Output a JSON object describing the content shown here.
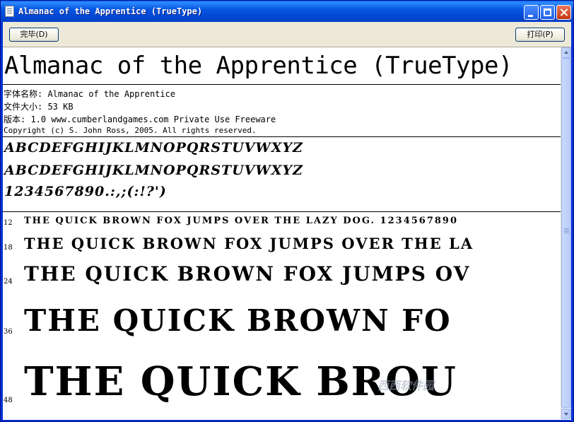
{
  "window": {
    "title": "Almanac of the Apprentice (TrueType)",
    "icon": "document-icon"
  },
  "toolbar": {
    "done_label": "完毕(D)",
    "print_label": "打印(P)"
  },
  "font_info": {
    "display_name": "Almanac of the Apprentice (TrueType)",
    "name_line": "字体名称: Almanac of the Apprentice",
    "size_line": "文件大小: 53 KB",
    "version_line": "版本: 1.0 www.cumberlandgames.com Private Use Freeware",
    "copyright_line": "Copyright (c) S. John Ross, 2005. All rights reserved."
  },
  "charset": {
    "uppercase_1": "ABCDEFGHIJKLMNOPQRSTUVWXYZ",
    "uppercase_2": "ABCDEFGHIJKLMNOPQRSTUVWXYZ",
    "digits_punct": "1234567890.:,;(:!?')"
  },
  "samples": [
    {
      "size": "12",
      "text": "THE QUICK BROWN FOX JUMPS OVER THE LAZY DOG. 1234567890"
    },
    {
      "size": "18",
      "text": "THE QUICK BROWN FOX JUMPS OVER THE LA"
    },
    {
      "size": "24",
      "text": "THE QUICK BROWN FOX JUMPS OV"
    },
    {
      "size": "36",
      "text": "THE QUICK BROWN FO"
    },
    {
      "size": "48",
      "text": "THE QUICK BROU"
    }
  ],
  "watermark": "西西软件园",
  "colors": {
    "titlebar": "#0757e3",
    "chrome": "#ece9d8"
  }
}
